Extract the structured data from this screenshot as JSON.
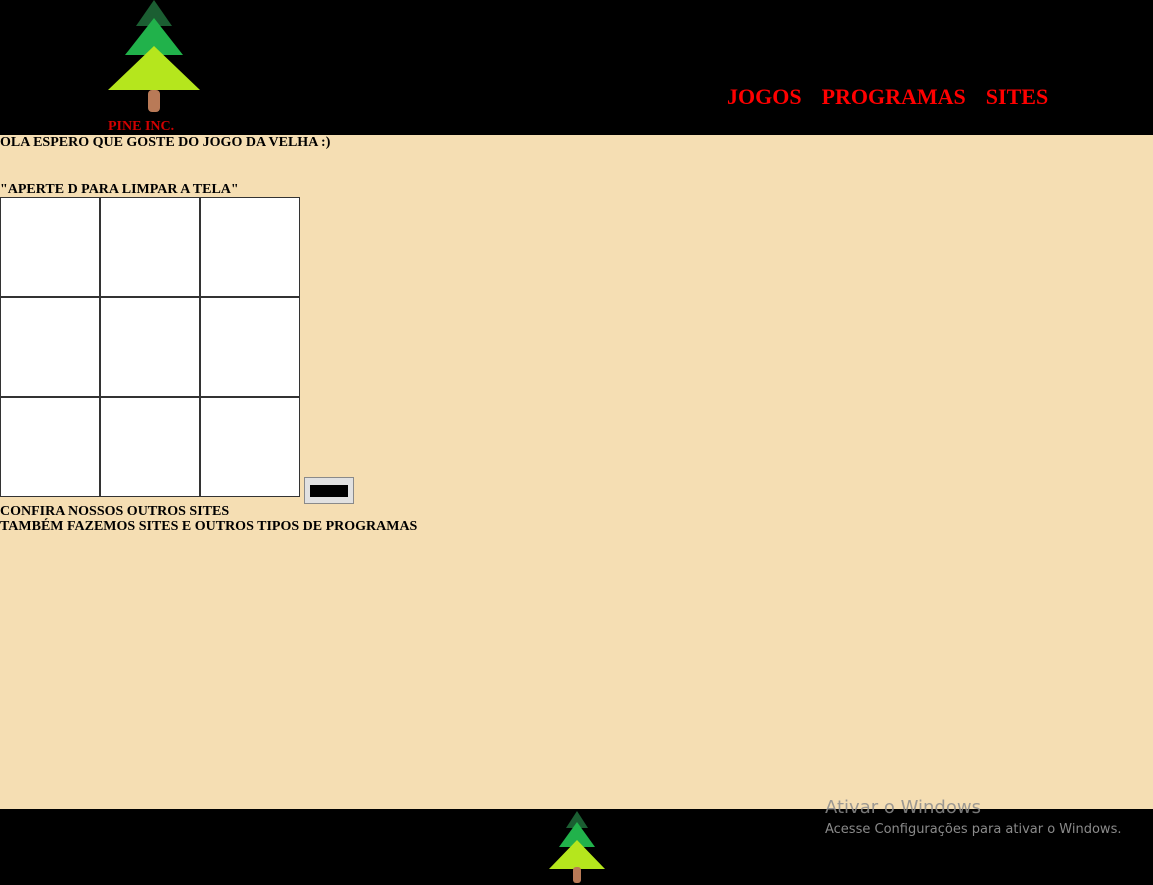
{
  "header": {
    "logo_icon": "pine-tree-icon",
    "brand": "PINE INC.",
    "nav": [
      {
        "label": "JOGOS"
      },
      {
        "label": "PROGRAMAS"
      },
      {
        "label": "SITES"
      }
    ]
  },
  "main": {
    "greeting": "OLA ESPERO QUE GOSTE DO JOGO DA VELHA :)",
    "instruction": "\"APERTE D PARA LIMPAR A TELA\"",
    "board_cells": [
      "",
      "",
      "",
      "",
      "",
      "",
      "",
      "",
      ""
    ],
    "clear_button_color": "#000000",
    "line1": "CONFIRA NOSSOS OUTROS SITES",
    "line2": "TAMBÉM FAZEMOS SITES E OUTROS TIPOS DE PROGRAMAS"
  },
  "footer": {
    "logo_icon": "pine-tree-icon"
  },
  "watermark": {
    "title": "Ativar o Windows",
    "subtitle": "Acesse Configurações para ativar o Windows."
  },
  "colors": {
    "page_bg": "#f5deb3",
    "header_bg": "#000000",
    "nav_link": "#ff0000",
    "brand": "#d20000",
    "tree_dark": "#1b5e32",
    "tree_mid": "#21b24b",
    "tree_light": "#b5e61d",
    "tree_trunk": "#b97a57"
  }
}
